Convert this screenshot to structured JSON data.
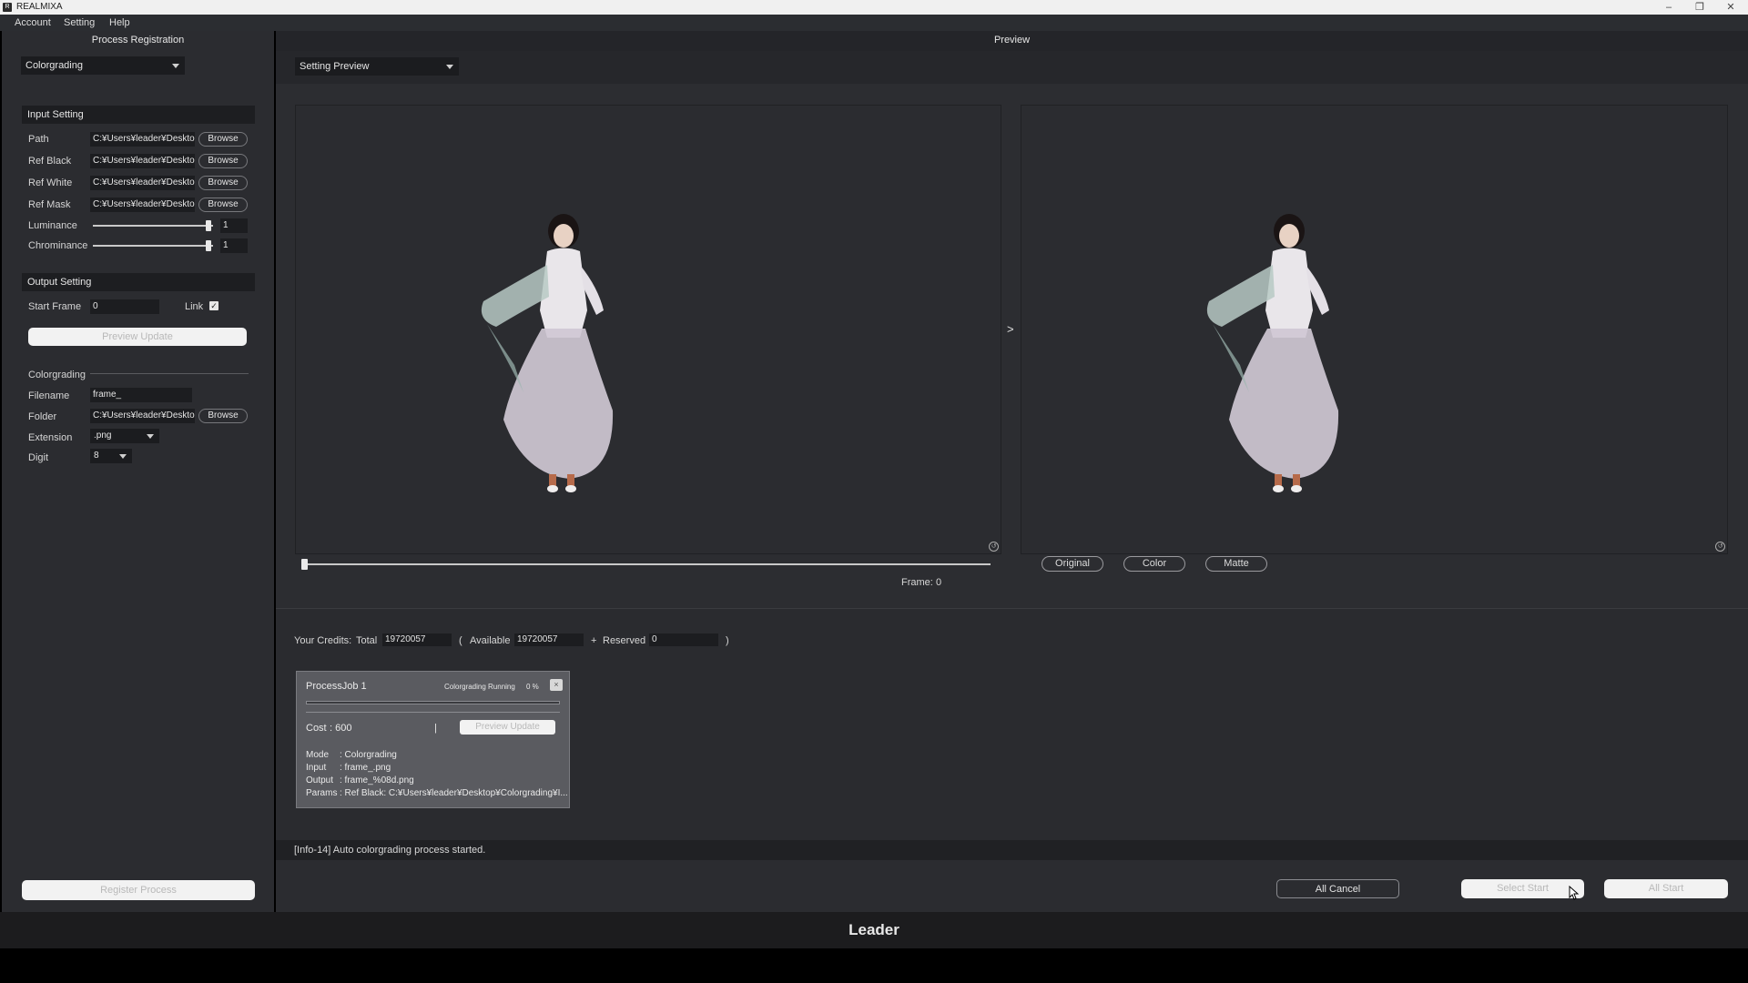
{
  "window": {
    "title": "REALMIXA",
    "icon_letter": "R",
    "minimize": "–",
    "restore": "❐",
    "close": "✕"
  },
  "menu": [
    "Account",
    "Setting",
    "Help"
  ],
  "left": {
    "title": "Process Registration",
    "process_type": "Colorgrading",
    "input_setting": {
      "heading": "Input Setting",
      "path_label": "Path",
      "path_value": "C:¥Users¥leader¥Desktop",
      "ref_black_label": "Ref Black",
      "ref_black_value": "C:¥Users¥leader¥Desktop",
      "ref_white_label": "Ref White",
      "ref_white_value": "C:¥Users¥leader¥Desktop",
      "ref_mask_label": "Ref Mask",
      "ref_mask_value": "C:¥Users¥leader¥Desktop",
      "browse_label": "Browse",
      "luminance_label": "Luminance",
      "luminance_value": "1",
      "chrominance_label": "Chrominance",
      "chrominance_value": "1"
    },
    "output_setting": {
      "heading": "Output Setting",
      "start_frame_label": "Start Frame",
      "start_frame_value": "0",
      "link_label": "Link",
      "link_checked": true,
      "preview_update": "Preview Update",
      "group_label": "Colorgrading",
      "filename_label": "Filename",
      "filename_value": "frame_",
      "folder_label": "Folder",
      "folder_value": "C:¥Users¥leader¥Desktop",
      "extension_label": "Extension",
      "extension_value": ".png",
      "digit_label": "Digit",
      "digit_value": "8"
    },
    "register_process": "Register Process"
  },
  "preview": {
    "title": "Preview",
    "mode_select": "Setting Preview",
    "arrow": ">",
    "frame_label": "Frame:",
    "frame_value": "0",
    "frame_position": 0,
    "buttons": [
      "Original",
      "Color",
      "Matte"
    ]
  },
  "credits": {
    "label": "Your Credits:",
    "total_label": "Total",
    "total_value": "19720057",
    "open_paren": "(",
    "available_label": "Available",
    "available_value": "19720057",
    "plus": "+",
    "reserved_label": "Reserved",
    "reserved_value": "0",
    "close_paren": ")"
  },
  "job": {
    "name": "ProcessJob 1",
    "status": "Colorgrading Running",
    "percent": "0 %",
    "progress": 0,
    "close": "×",
    "cost_label": "Cost",
    "cost_value": ": 600",
    "separator": "|",
    "preview_update": "Preview Update",
    "mode_label": "Mode",
    "mode_value": ": Colorgrading",
    "input_label": "Input",
    "input_value": ": frame_.png",
    "output_label": "Output",
    "output_value": ": frame_%08d.png",
    "params_label": "Params",
    "params_value": ": Ref Black: C:¥Users¥leader¥Desktop¥Colorgrading¥I..."
  },
  "status_message": "[Info-14] Auto colorgrading process started.",
  "actions": {
    "all_cancel": "All Cancel",
    "select_start": "Select Start",
    "all_start": "All Start"
  },
  "footer": "Leader",
  "colors": {
    "panel": "#2b2c30",
    "field": "#1c1d20",
    "job_card": "#5a5b60"
  }
}
